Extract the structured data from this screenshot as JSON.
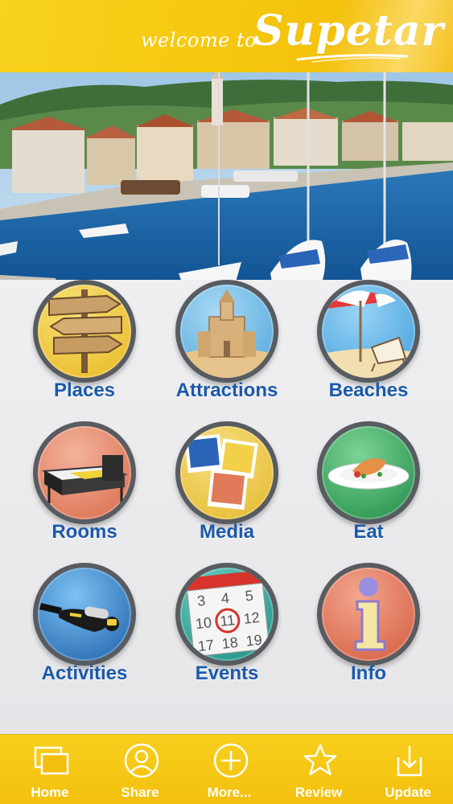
{
  "header": {
    "welcome_text": "welcome to",
    "brand_name": "Supetar"
  },
  "photo": {
    "subject": "Supetar harbor with sailboats"
  },
  "menu": {
    "items": [
      {
        "label": "Places",
        "icon": "signpost-icon",
        "color": "#f2d043"
      },
      {
        "label": "Attractions",
        "icon": "church-icon",
        "color": "#69b7e6"
      },
      {
        "label": "Beaches",
        "icon": "beach-umbrella-icon",
        "color": "#5ab4ea"
      },
      {
        "label": "Rooms",
        "icon": "bed-icon",
        "color": "#e88a6c"
      },
      {
        "label": "Media",
        "icon": "photos-icon",
        "color": "#f0cf45"
      },
      {
        "label": "Eat",
        "icon": "plate-icon",
        "color": "#33a45a"
      },
      {
        "label": "Activities",
        "icon": "diver-icon",
        "color": "#2f78c0"
      },
      {
        "label": "Events",
        "icon": "calendar-icon",
        "color": "#2aa79a"
      },
      {
        "label": "Info",
        "icon": "info-icon",
        "color": "#e27a5e"
      }
    ]
  },
  "calendar": {
    "days": [
      "3",
      "4",
      "5",
      "10",
      "11",
      "12",
      "17",
      "18",
      "19"
    ]
  },
  "info_glyph": "i",
  "tabbar": {
    "items": [
      {
        "label": "Home",
        "icon": "home-windows-icon"
      },
      {
        "label": "Share",
        "icon": "share-person-icon"
      },
      {
        "label": "More...",
        "icon": "plus-circle-icon"
      },
      {
        "label": "Review",
        "icon": "star-icon"
      },
      {
        "label": "Update",
        "icon": "download-icon"
      }
    ]
  }
}
